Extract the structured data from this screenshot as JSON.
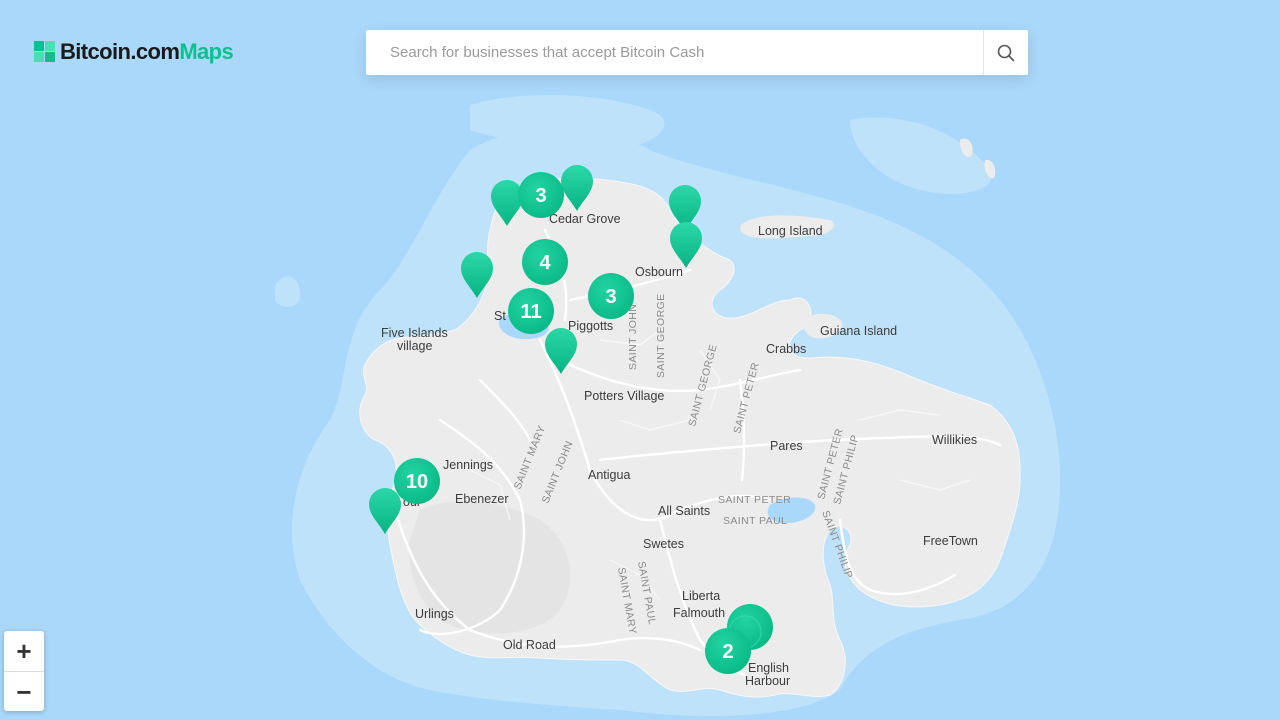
{
  "brand": {
    "logo_text_dark": "Bitcoin.com",
    "logo_text_accent": "Maps",
    "accent_color": "#0ac18e"
  },
  "search": {
    "placeholder": "Search for businesses that accept Bitcoin Cash",
    "value": "",
    "icon": "search-icon"
  },
  "zoom": {
    "in_label": "+",
    "out_label": "−"
  },
  "map": {
    "water_color": "#a9d8fb",
    "land_color": "#ececec",
    "places": [
      {
        "name": "Cedar Grove"
      },
      {
        "name": "Long Island"
      },
      {
        "name": "Osbourn"
      },
      {
        "name": "Five Islands"
      },
      {
        "name": "village"
      },
      {
        "name": "St"
      },
      {
        "name": "Piggotts"
      },
      {
        "name": "Guiana Island"
      },
      {
        "name": "Crabbs"
      },
      {
        "name": "Potters Village"
      },
      {
        "name": "Pares"
      },
      {
        "name": "Willikies"
      },
      {
        "name": "Jennings"
      },
      {
        "name": "Antigua"
      },
      {
        "name": "Ebenezer"
      },
      {
        "name": "All Saints"
      },
      {
        "name": "FreeTown"
      },
      {
        "name": "Swetes"
      },
      {
        "name": "Liberta"
      },
      {
        "name": "Falmouth"
      },
      {
        "name": "Urlings"
      },
      {
        "name": "Old Road"
      },
      {
        "name": "English"
      },
      {
        "name": "Harbour"
      },
      {
        "name": "our"
      }
    ],
    "parishes": [
      {
        "name": "SAINT JOHN"
      },
      {
        "name": "SAINT GEORGE"
      },
      {
        "name": "SAINT GEORGE"
      },
      {
        "name": "SAINT PETER"
      },
      {
        "name": "SAINT MARY"
      },
      {
        "name": "SAINT JOHN"
      },
      {
        "name": "SAINT PETER"
      },
      {
        "name": "SAINT PAUL"
      },
      {
        "name": "SAINT PETER"
      },
      {
        "name": "SAINT PHILIP"
      },
      {
        "name": "SAINT PHILIP"
      },
      {
        "name": "SAINT MARY"
      },
      {
        "name": "SAINT PAUL"
      }
    ],
    "clusters": [
      {
        "count": "3"
      },
      {
        "count": "4"
      },
      {
        "count": "11"
      },
      {
        "count": "3"
      },
      {
        "count": "10"
      },
      {
        "count": "2"
      }
    ],
    "marker_count": 8
  }
}
